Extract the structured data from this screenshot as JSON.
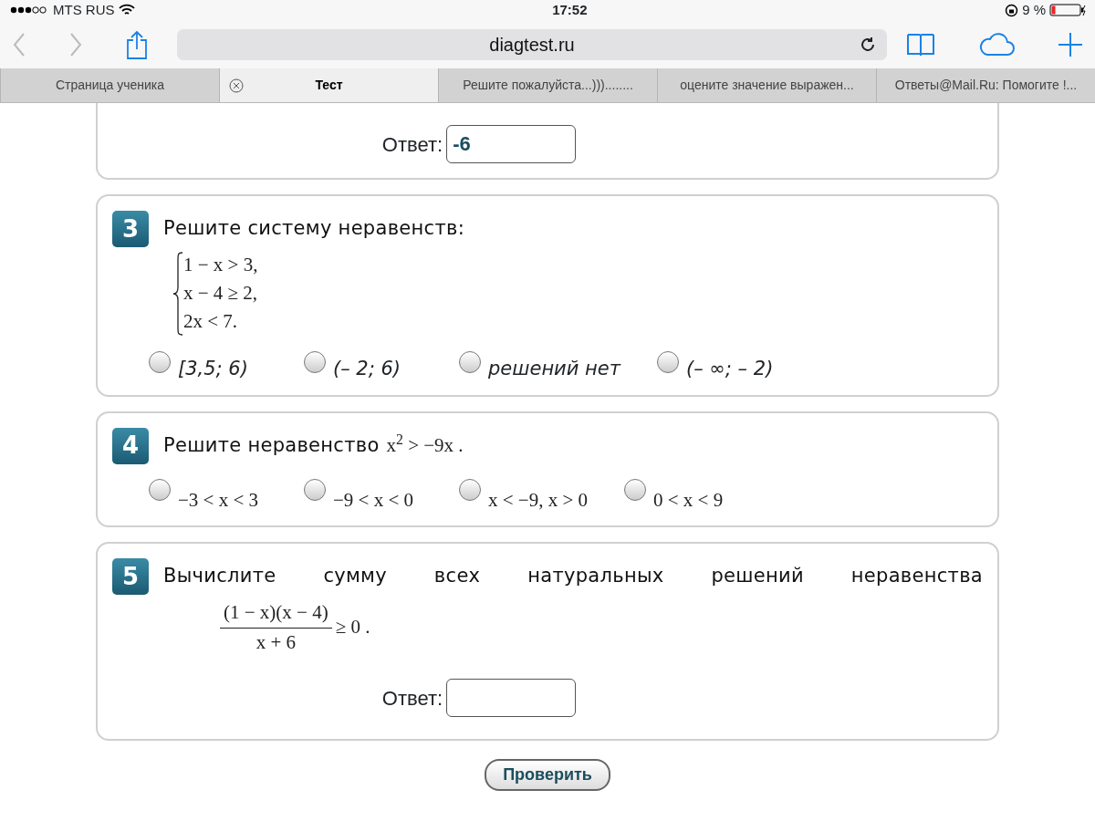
{
  "status_bar": {
    "carrier": "MTS RUS",
    "time": "17:52",
    "battery": "9 %"
  },
  "toolbar": {
    "address": "diagtest.ru"
  },
  "tabs": [
    {
      "label": "Страница ученика",
      "selected": false
    },
    {
      "label": "Тест",
      "selected": true
    },
    {
      "label": "Решите пожалуйста...)))........",
      "selected": false
    },
    {
      "label": "оцените значение выражен...",
      "selected": false
    },
    {
      "label": "Ответы@Mail.Ru: Помогите !...",
      "selected": false
    }
  ],
  "questions": [
    {
      "kind": "answer",
      "answer_label": "Ответ:",
      "answer_value": "-6"
    },
    {
      "kind": "system",
      "number": "3",
      "title": "Решите систему неравенств:",
      "system": [
        "1 − x > 3,",
        "x − 4 ≥ 2,",
        "2x < 7."
      ],
      "options": [
        {
          "label": "[3,5; 6)",
          "selected": false
        },
        {
          "label": "(– 2; 6)",
          "selected": false
        },
        {
          "label": "решений нет",
          "selected": false
        },
        {
          "label": "(– ∞; – 2)",
          "selected": false
        }
      ]
    },
    {
      "kind": "inline",
      "number": "4",
      "title": "Решите неравенство",
      "title_math": "x$^{2}$ > −9x .",
      "options": [
        {
          "label": "−3 < x < 3",
          "selected": false
        },
        {
          "label": "−9 < x < 0",
          "selected": false
        },
        {
          "label": "x < −9, x > 0",
          "selected": false
        },
        {
          "label": "0 < x < 9",
          "selected": false
        }
      ]
    },
    {
      "kind": "fraction",
      "number": "5",
      "title": "Вычислите сумму всех натуральных решений неравенства",
      "numerator": "(1 − x)(x − 4)",
      "denominator": "x + 6",
      "relation": "≥ 0 .",
      "answer_label": "Ответ:"
    }
  ],
  "submit": "Проверить"
}
